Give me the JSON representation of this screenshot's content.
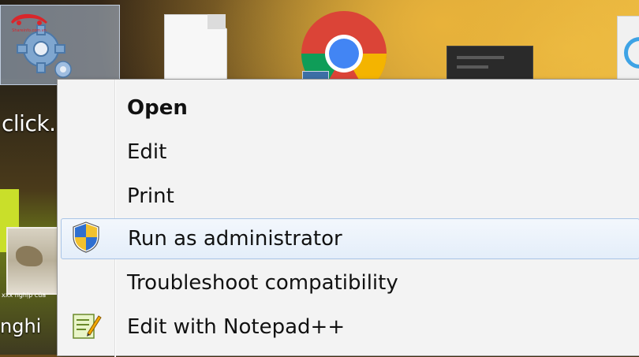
{
  "watermark": {
    "text": "Shareinfo.com.vn",
    "icon": "car-logo-icon"
  },
  "desktop": {
    "selected_icon": {
      "icon": "gear-icon",
      "label": "click."
    },
    "left_label": "nghi",
    "thumbnail_caption": "xxx nghịp của",
    "icons": [
      "document-icon",
      "chrome-icon",
      "dark-app-icon",
      "ie-icon"
    ]
  },
  "context_menu": {
    "items": [
      {
        "label": "Open",
        "bold": true,
        "icon": null
      },
      {
        "label": "Edit",
        "bold": false,
        "icon": null
      },
      {
        "label": "Print",
        "bold": false,
        "icon": null
      },
      {
        "label": "Run as administrator",
        "bold": false,
        "icon": "uac-shield-icon",
        "highlighted": true
      },
      {
        "label": "Troubleshoot compatibility",
        "bold": false,
        "icon": null
      },
      {
        "label": "Edit with Notepad++",
        "bold": false,
        "icon": "notepad-plus-plus-icon"
      }
    ]
  },
  "colors": {
    "menu_background": "#f3f3f3",
    "highlight_border": "#a8c4e6",
    "shield_blue": "#2f6fd0",
    "shield_yellow": "#f2c12e"
  }
}
